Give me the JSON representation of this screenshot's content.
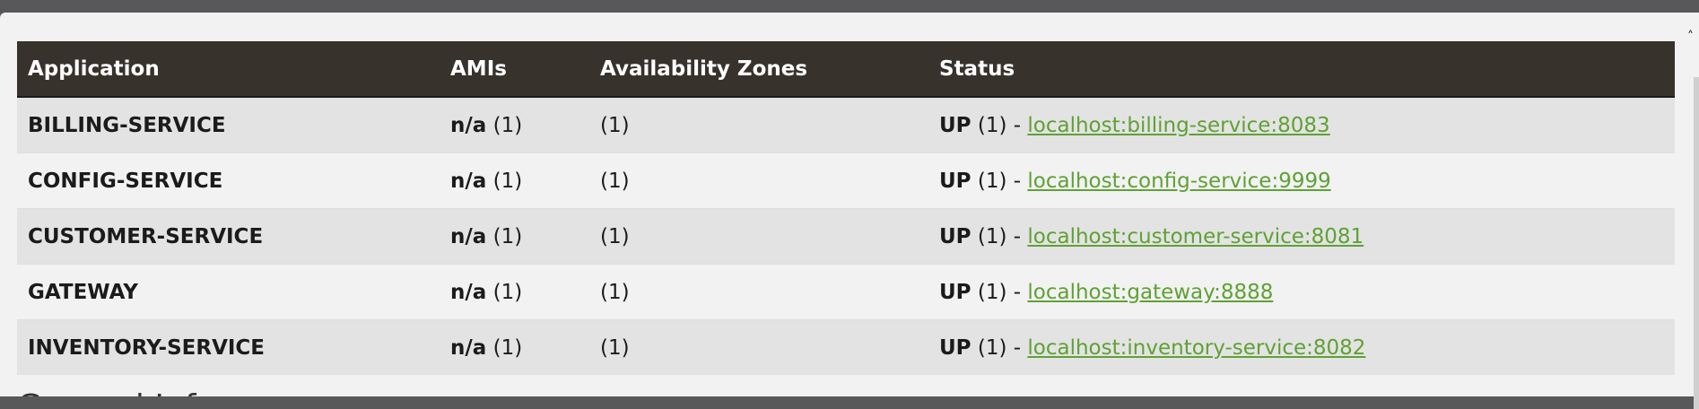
{
  "table": {
    "headers": {
      "application": "Application",
      "amis": "AMIs",
      "zones": "Availability Zones",
      "status": "Status"
    },
    "rows": [
      {
        "application": "BILLING-SERVICE",
        "amis_value": "n/a",
        "amis_count": "(1)",
        "zones": "(1)",
        "status": "UP",
        "status_count": "(1)",
        "separator": "-",
        "instance_link": "localhost:billing-service:8083"
      },
      {
        "application": "CONFIG-SERVICE",
        "amis_value": "n/a",
        "amis_count": "(1)",
        "zones": "(1)",
        "status": "UP",
        "status_count": "(1)",
        "separator": "-",
        "instance_link": "localhost:config-service:9999"
      },
      {
        "application": "CUSTOMER-SERVICE",
        "amis_value": "n/a",
        "amis_count": "(1)",
        "zones": "(1)",
        "status": "UP",
        "status_count": "(1)",
        "separator": "-",
        "instance_link": "localhost:customer-service:8081"
      },
      {
        "application": "GATEWAY",
        "amis_value": "n/a",
        "amis_count": "(1)",
        "zones": "(1)",
        "status": "UP",
        "status_count": "(1)",
        "separator": "-",
        "instance_link": "localhost:gateway:8888"
      },
      {
        "application": "INVENTORY-SERVICE",
        "amis_value": "n/a",
        "amis_count": "(1)",
        "zones": "(1)",
        "status": "UP",
        "status_count": "(1)",
        "separator": "-",
        "instance_link": "localhost:inventory-service:8082"
      }
    ]
  },
  "next_section": {
    "title": "General Info"
  },
  "colors": {
    "header_bg": "#38322d",
    "link": "#5fa134",
    "row_odd": "#e3e3e3",
    "row_even": "#f2f2f2"
  },
  "icons": {
    "scroll_up": "chevron-up-icon"
  }
}
